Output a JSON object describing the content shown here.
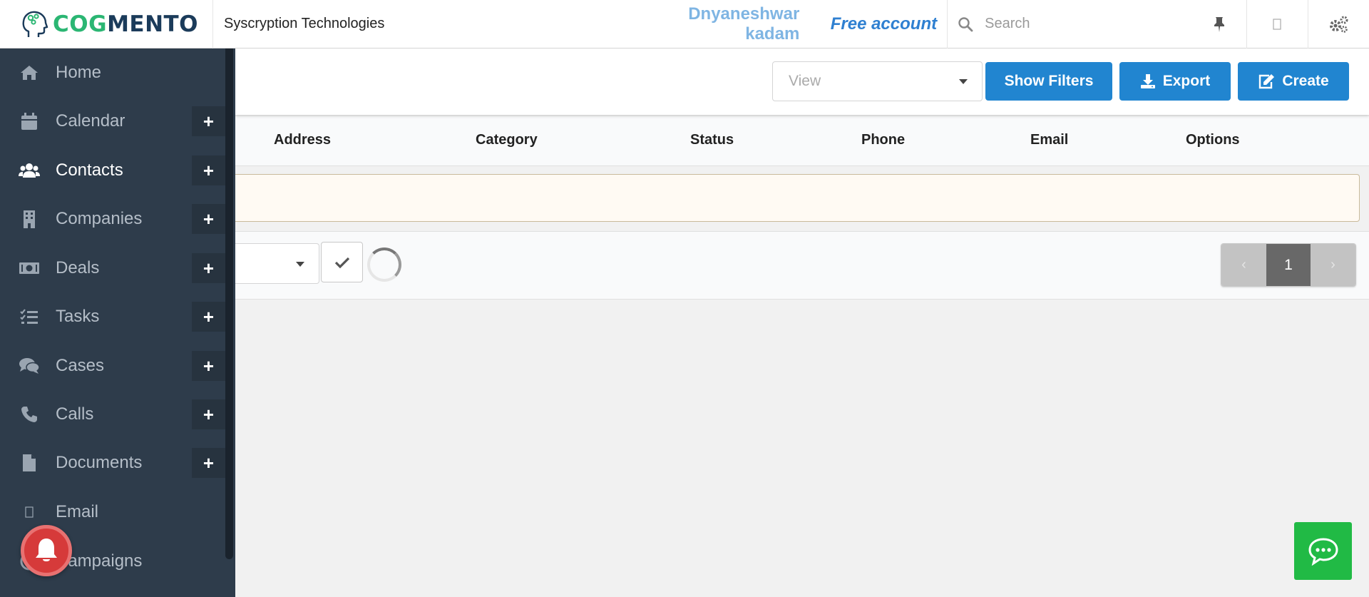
{
  "header": {
    "logo_part1": "COG",
    "logo_part2": "MENTO",
    "company": "Syscryption Technologies",
    "user_name": "Dnyaneshwar kadam",
    "account_type": "Free account",
    "search_placeholder": "Search"
  },
  "sidebar": {
    "items": [
      {
        "label": "Home",
        "icon": "home-icon",
        "has_plus": false
      },
      {
        "label": "Calendar",
        "icon": "calendar-icon",
        "has_plus": true
      },
      {
        "label": "Contacts",
        "icon": "users-icon",
        "has_plus": true,
        "active": true
      },
      {
        "label": "Companies",
        "icon": "building-icon",
        "has_plus": true
      },
      {
        "label": "Deals",
        "icon": "money-icon",
        "has_plus": true
      },
      {
        "label": "Tasks",
        "icon": "tasks-icon",
        "has_plus": true
      },
      {
        "label": "Cases",
        "icon": "comments-icon",
        "has_plus": true
      },
      {
        "label": "Calls",
        "icon": "phone-icon",
        "has_plus": true
      },
      {
        "label": "Documents",
        "icon": "file-icon",
        "has_plus": true
      },
      {
        "label": "Email",
        "icon": "email-icon",
        "has_plus": false
      },
      {
        "label": "Campaigns",
        "icon": "campaign-icon",
        "has_plus": false
      }
    ],
    "plus_symbol": "+"
  },
  "toolbar": {
    "view_placeholder": "View",
    "show_filters_label": "Show Filters",
    "export_label": "Export",
    "create_label": "Create"
  },
  "table": {
    "columns": [
      "Address",
      "Category",
      "Status",
      "Phone",
      "Email",
      "Options"
    ]
  },
  "pagination": {
    "prev": "‹",
    "current": "1",
    "next": "›"
  },
  "colors": {
    "primary": "#2185d0",
    "sidebar_bg": "#2e3c4b",
    "chat_green": "#21ba45",
    "bell_red": "#d63a3a"
  }
}
